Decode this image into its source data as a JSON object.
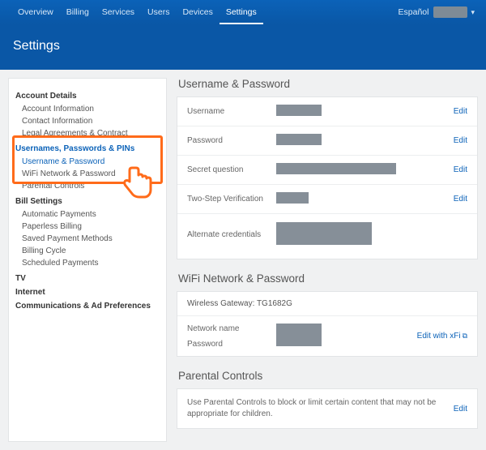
{
  "nav": {
    "items": [
      "Overview",
      "Billing",
      "Services",
      "Users",
      "Devices",
      "Settings"
    ],
    "active": "Settings",
    "language": "Español"
  },
  "page_title": "Settings",
  "sidebar": {
    "group1": {
      "title": "Account Details",
      "items": [
        "Account Information",
        "Contact Information",
        "Legal Agreements & Contract"
      ]
    },
    "group2": {
      "title": "Usernames, Passwords & PINs",
      "items": [
        "Username & Password",
        "WiFi Network & Password",
        "Parental Controls"
      ]
    },
    "group3": {
      "title": "Bill Settings",
      "items": [
        "Automatic Payments",
        "Paperless Billing",
        "Saved Payment Methods",
        "Billing Cycle",
        "Scheduled Payments"
      ]
    },
    "group4": {
      "title": "TV"
    },
    "group5": {
      "title": "Internet"
    },
    "group6": {
      "title": "Communications & Ad Preferences"
    }
  },
  "sections": {
    "userpass": {
      "title": "Username & Password",
      "rows": {
        "username": {
          "label": "Username",
          "edit": "Edit"
        },
        "password": {
          "label": "Password",
          "edit": "Edit"
        },
        "secret": {
          "label": "Secret question",
          "edit": "Edit"
        },
        "twostep": {
          "label": "Two-Step Verification",
          "edit": "Edit"
        },
        "altcred": {
          "label": "Alternate credentials"
        }
      }
    },
    "wifi": {
      "title": "WiFi Network & Password",
      "gateway_label": "Wireless Gateway: TG1682G",
      "network_label": "Network name",
      "password_label": "Password",
      "edit": "Edit with xFi"
    },
    "parental": {
      "title": "Parental Controls",
      "desc": "Use Parental Controls to block or limit certain content that may not be appropriate for children.",
      "edit": "Edit"
    }
  }
}
